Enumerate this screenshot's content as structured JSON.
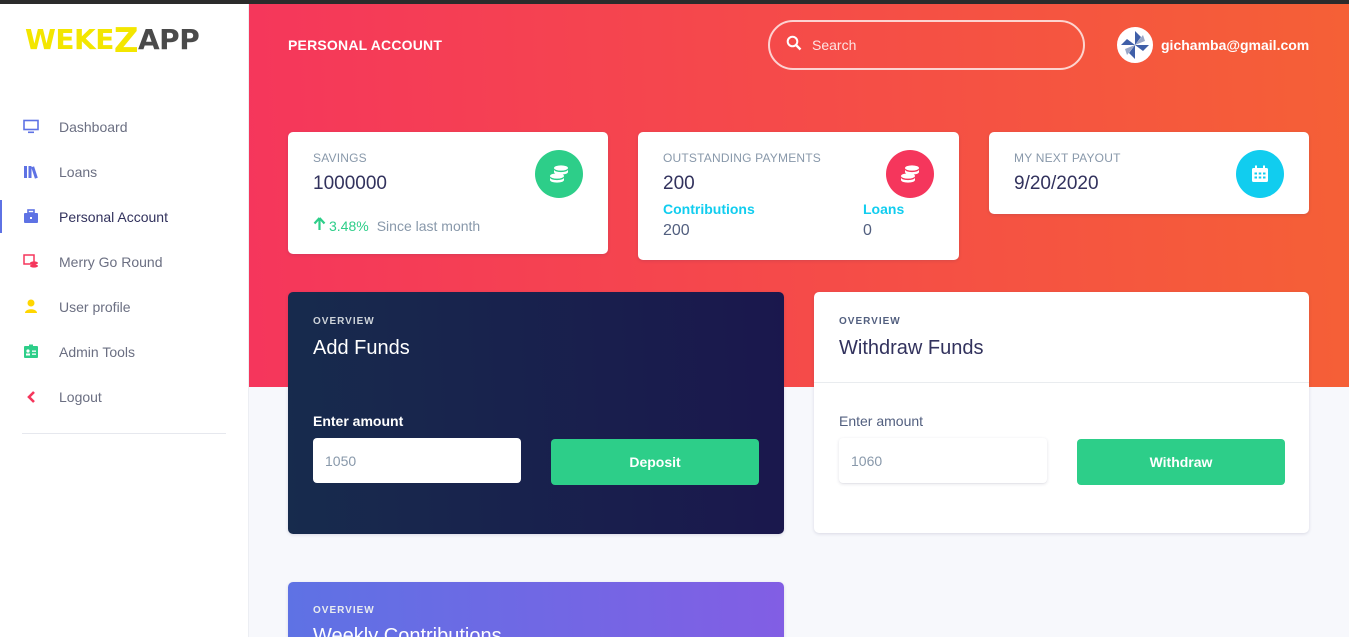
{
  "brand": {
    "part1": "WEKE",
    "part2": "Z",
    "part3": "APP"
  },
  "sidebar": {
    "items": [
      {
        "label": "Dashboard",
        "icon": "monitor-icon",
        "color": "#5e72e4"
      },
      {
        "label": "Loans",
        "icon": "books-icon",
        "color": "#5e72e4"
      },
      {
        "label": "Personal Account",
        "icon": "briefcase-icon",
        "color": "#5e72e4",
        "active": true
      },
      {
        "label": "Merry Go Round",
        "icon": "coins-icon",
        "color": "#f5365c"
      },
      {
        "label": "User profile",
        "icon": "user-icon",
        "color": "#ffd600"
      },
      {
        "label": "Admin Tools",
        "icon": "id-card-icon",
        "color": "#2dce89"
      },
      {
        "label": "Logout",
        "icon": "chevron-left-icon",
        "color": "#f5365c"
      }
    ]
  },
  "header": {
    "title": "PERSONAL ACCOUNT",
    "search_placeholder": "Search",
    "user_email": "gichamba@gmail.com"
  },
  "stats": {
    "savings": {
      "title": "SAVINGS",
      "value": "1000000",
      "change": "3.48%",
      "since": "Since last month",
      "icon": "coins-icon",
      "color": "#2dce89"
    },
    "outstanding": {
      "title": "OUTSTANDING PAYMENTS",
      "value": "200",
      "contributions_label": "Contributions",
      "contributions_value": "200",
      "loans_label": "Loans",
      "loans_value": "0",
      "icon": "coins-icon",
      "color": "#f5365c"
    },
    "payout": {
      "title": "MY NEXT PAYOUT",
      "value": "9/20/2020",
      "icon": "calendar-icon",
      "color": "#11cdef"
    }
  },
  "add_funds": {
    "overview": "OVERVIEW",
    "title": "Add Funds",
    "amount_label": "Enter amount",
    "amount_value": "1050",
    "button": "Deposit"
  },
  "withdraw_funds": {
    "overview": "OVERVIEW",
    "title": "Withdraw Funds",
    "amount_label": "Enter amount",
    "amount_value": "1060",
    "button": "Withdraw"
  },
  "weekly": {
    "overview": "OVERVIEW",
    "title": "Weekly Contributions"
  },
  "colors": {
    "primary": "#5e72e4",
    "danger": "#f5365c",
    "success": "#2dce89",
    "info": "#11cdef",
    "dark": "#172b4d"
  }
}
